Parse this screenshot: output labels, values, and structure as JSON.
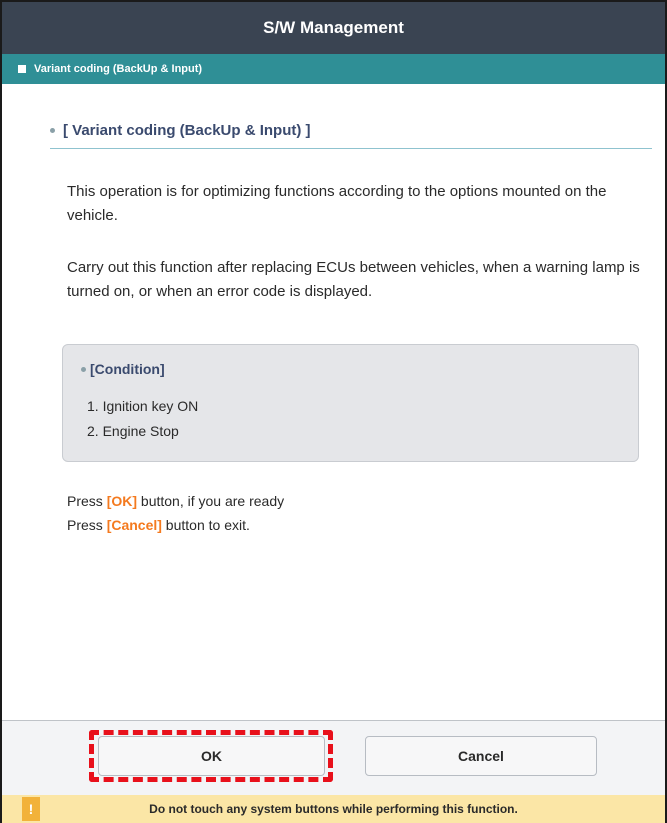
{
  "window": {
    "title": "S/W Management"
  },
  "subheader": {
    "label": "Variant coding (BackUp & Input)"
  },
  "section": {
    "title": "[ Variant coding (BackUp & Input) ]"
  },
  "description": {
    "para1": "This operation is for optimizing functions according to the options mounted on the vehicle.",
    "para2": "Carry out this function after replacing ECUs between vehicles, when a warning lamp is turned on, or when an error code is displayed."
  },
  "condition": {
    "title": "[Condition]",
    "items": [
      "1. Ignition key ON",
      "2. Engine Stop"
    ]
  },
  "instructions": {
    "line1_prefix": "Press ",
    "line1_key": "[OK]",
    "line1_suffix": " button, if you are ready",
    "line2_prefix": "Press ",
    "line2_key": "[Cancel]",
    "line2_suffix": " button to exit."
  },
  "buttons": {
    "ok": "OK",
    "cancel": "Cancel"
  },
  "warning": {
    "icon": "!",
    "text": "Do not touch any system buttons while performing this function."
  },
  "colors": {
    "titlebar": "#3a4452",
    "subheader": "#2f8f96",
    "accent_orange": "#f47a1f",
    "highlight_red": "#e8101b",
    "warning_bg": "#fbe6a6"
  }
}
